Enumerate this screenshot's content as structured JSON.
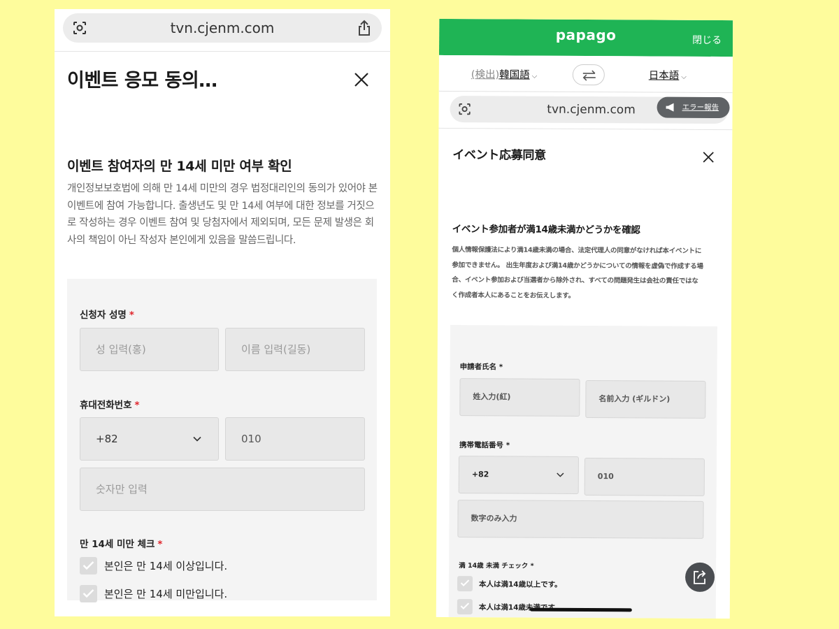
{
  "left": {
    "url": "tvn.cjenm.com",
    "title": "이벤트 응모 동의…",
    "section_title": "이벤트 참여자의 만 14세 미만 여부 확인",
    "description": "개인정보보호법에 의해 만 14세 미만의 경우 법정대리인의 동의가 있어야 본 이벤트에 참여 가능합니다. 출생년도 및 만 14세 여부에 대한 정보를 거짓으로 작성하는 경우 이벤트 참여 및 당첨자에서 제외되며, 모든 문제 발생은 회사의 책임이 아닌 작성자 본인에게 있음을 말씀드립니다.",
    "required_mark": "*",
    "name_label": "신청자 성명",
    "last_name_placeholder": "성 입력(홍)",
    "first_name_placeholder": "이름 입력(길동)",
    "phone_label": "휴대전화번호",
    "country_code": "+82",
    "phone_prefix": "010",
    "phone_number_placeholder": "숫자만 입력",
    "age_label": "만 14세 미만 체크",
    "option_over": "본인은 만 14세 이상입니다.",
    "option_under": "본인은 만 14세 미만입니다."
  },
  "right": {
    "app_name": "papago",
    "close_label": "閉じる",
    "source_lang_detect": "(検出)",
    "source_lang": "韓国語",
    "target_lang": "日本語",
    "url": "tvn.cjenm.com",
    "error_report": "エラー報告",
    "title": "イベント応募同意",
    "section_title": "イベント参加者が満14歳未満かどうかを確認",
    "description": "個人情報保護法により満14歳未満の場合、法定代理人の同意がなければ本イベントに参加できません。 出生年度および満14歳かどうかについての情報を虚偽で作成する場合、イベント参加および当選者から除外され、すべての問題発生は会社の責任ではなく作成者本人にあることをお伝えします。",
    "required_mark": "*",
    "name_label": "申請者氏名",
    "last_name_placeholder": "姓入力(紅)",
    "first_name_placeholder": "名前入力 (ギルドン)",
    "phone_label": "携帯電話番号",
    "country_code": "+82",
    "phone_prefix": "010",
    "phone_number_placeholder": "数字のみ入力",
    "age_label": "満 14歳 未満 チェック",
    "option_over": "本人は満14歳以上です。",
    "option_under": "本人は満14歳未満です。"
  },
  "colors": {
    "background": "#fefc9c",
    "papago_green": "#1fb455",
    "required_red": "#e0242b"
  }
}
